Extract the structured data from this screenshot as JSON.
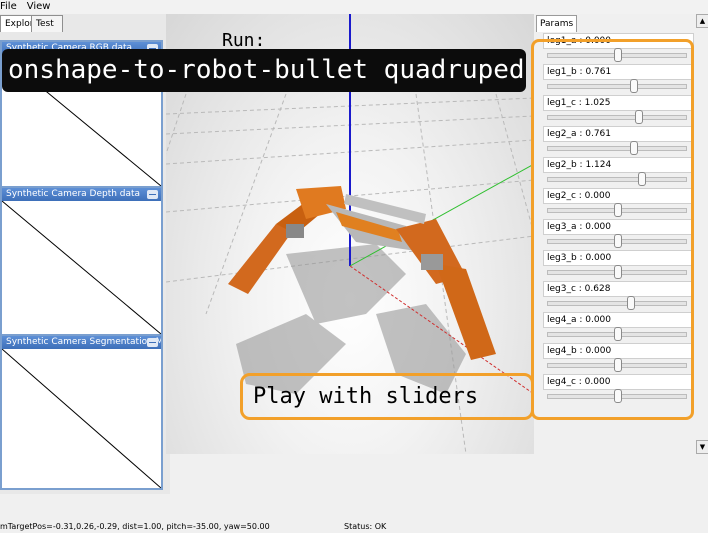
{
  "menubar": {
    "items": [
      "File",
      "View"
    ]
  },
  "explorer": {
    "tabs": [
      "Explorer",
      "Test"
    ],
    "panels": [
      {
        "title": "Synthetic Camera RGB data"
      },
      {
        "title": "Synthetic Camera Depth data"
      },
      {
        "title": "Synthetic Camera Segmentation Mask"
      }
    ]
  },
  "viewport": {
    "run_label": "Run:"
  },
  "params": {
    "tab_label": "Params",
    "sliders": [
      {
        "label": "leg1_a : 0.000",
        "fraction": 0.5
      },
      {
        "label": "leg1_b : 0.761",
        "fraction": 0.62
      },
      {
        "label": "leg1_c : 1.025",
        "fraction": 0.66
      },
      {
        "label": "leg2_a : 0.761",
        "fraction": 0.62
      },
      {
        "label": "leg2_b : 1.124",
        "fraction": 0.68
      },
      {
        "label": "leg2_c : 0.000",
        "fraction": 0.5
      },
      {
        "label": "leg3_a : 0.000",
        "fraction": 0.5
      },
      {
        "label": "leg3_b : 0.000",
        "fraction": 0.5
      },
      {
        "label": "leg3_c : 0.628",
        "fraction": 0.6
      },
      {
        "label": "leg4_a : 0.000",
        "fraction": 0.5
      },
      {
        "label": "leg4_b : 0.000",
        "fraction": 0.5
      },
      {
        "label": "leg4_c : 0.000",
        "fraction": 0.5
      }
    ]
  },
  "overlays": {
    "title": "onshape-to-robot-bullet quadruped",
    "callout": "Play with sliders"
  },
  "statusbar": {
    "camera": "mTargetPos=-0.31,0.26,-0.29, dist=1.00, pitch=-35.00, yaw=50.00",
    "status": "Status: OK"
  },
  "colors": {
    "accent": "#f2a02a",
    "panel_title": "#3d6fb9",
    "robot_orange": "#d2691e"
  }
}
